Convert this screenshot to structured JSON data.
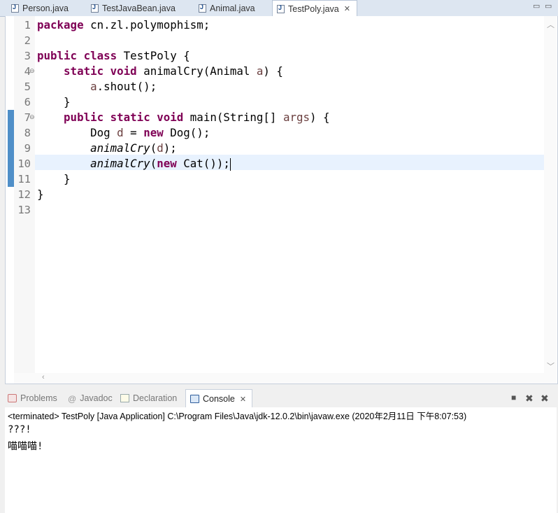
{
  "editor_tabs": [
    {
      "label": "Person.java",
      "active": false
    },
    {
      "label": "TestJavaBean.java",
      "active": false
    },
    {
      "label": "Animal.java",
      "active": false
    },
    {
      "label": "TestPoly.java",
      "active": true
    }
  ],
  "editor": {
    "line_numbers": [
      "1",
      "2",
      "3",
      "4",
      "5",
      "6",
      "7",
      "8",
      "9",
      "10",
      "11",
      "12",
      "13"
    ],
    "lines": {
      "l1": {
        "kw": "package",
        "rest": " cn.zl.polymophism;"
      },
      "l3": {
        "kw1": "public",
        "kw2": "class",
        "rest": " TestPoly {"
      },
      "l4": {
        "indent": "    ",
        "kw1": "static",
        "kw2": "void",
        "t1": " animalCry(Animal ",
        "param": "a",
        "t2": ") {"
      },
      "l5": {
        "indent": "        ",
        "var": "a",
        "rest": ".shout();"
      },
      "l6": {
        "text": "    }"
      },
      "l7": {
        "indent": "    ",
        "kw1": "public",
        "kw2": "static",
        "kw3": "void",
        "t1": " main(String[] ",
        "param": "args",
        "t2": ") {"
      },
      "l8": {
        "indent": "        ",
        "t1": "Dog ",
        "var": "d",
        "t2": " = ",
        "kw": "new",
        "t3": " Dog();"
      },
      "l9": {
        "indent": "        ",
        "method": "animalCry",
        "t1": "(",
        "var": "d",
        "t2": ");"
      },
      "l10": {
        "indent": "        ",
        "method": "animalCry",
        "t1": "(",
        "kw": "new",
        "t2": " Cat());"
      },
      "l11": {
        "text": "    }"
      },
      "l12": {
        "text": "}"
      }
    }
  },
  "panel": {
    "tabs": {
      "problems": "Problems",
      "javadoc": "Javadoc",
      "declaration": "Declaration",
      "console": "Console"
    },
    "console_header": "<terminated> TestPoly [Java Application] C:\\Program Files\\Java\\jdk-12.0.2\\bin\\javaw.exe (2020年2月11日 下午8:07:53)",
    "output": [
      "???!",
      "喵喵喵!"
    ]
  },
  "colors": {
    "keyword": "#7f0055",
    "current_line": "#e8f2fe",
    "change_ruler": "#4f8fc8"
  }
}
